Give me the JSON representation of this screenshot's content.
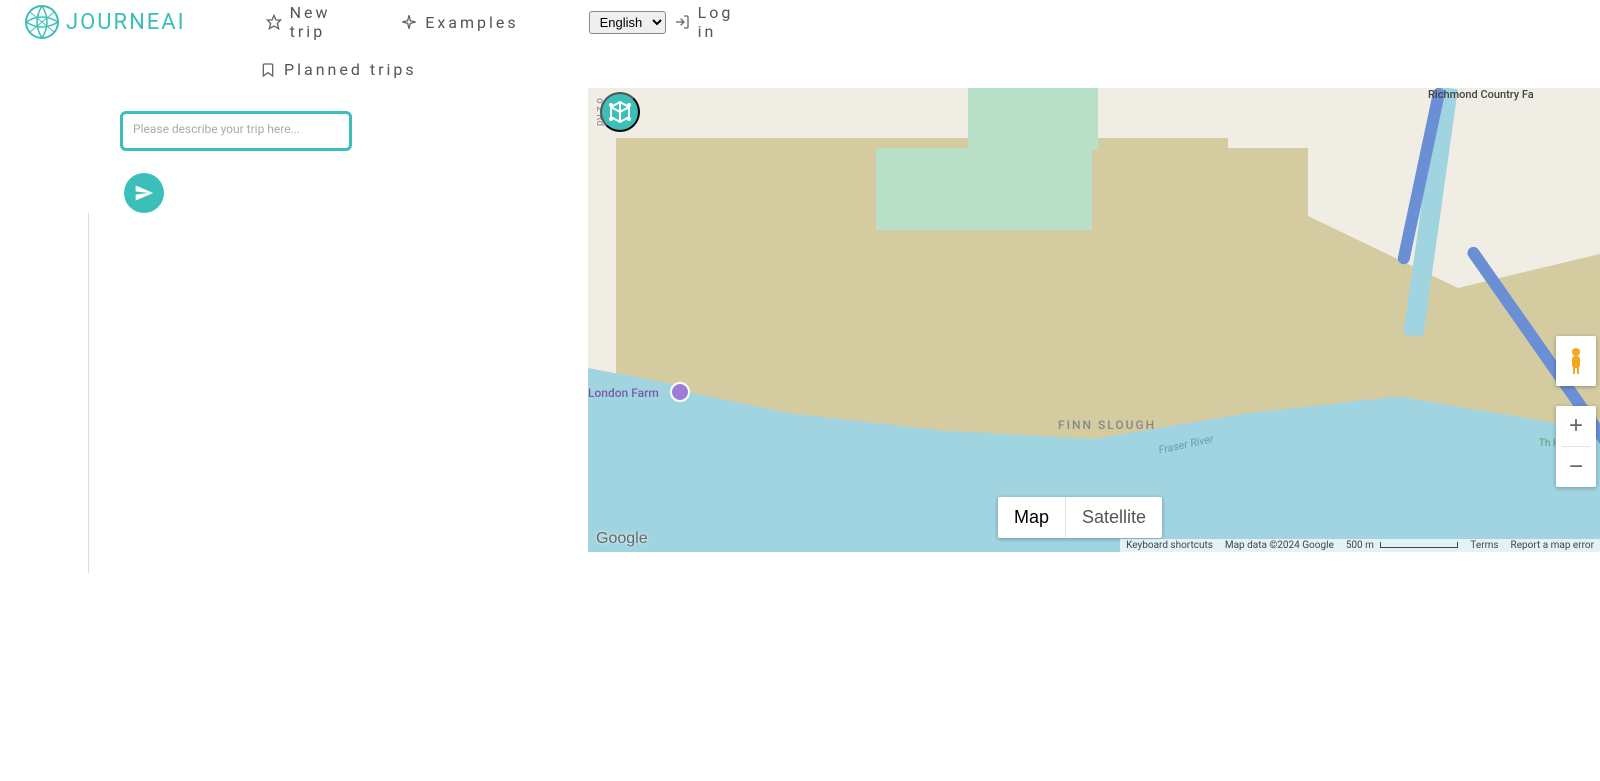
{
  "brand": {
    "name": "JOURNEAI"
  },
  "nav": {
    "new_trip": "New trip",
    "examples": "Examples",
    "planned_trips": "Planned trips",
    "login": "Log in"
  },
  "language": {
    "selected": "English",
    "options": [
      "English"
    ]
  },
  "input": {
    "placeholder": "Please describe your trip here..."
  },
  "map": {
    "type_map": "Map",
    "type_satellite": "Satellite",
    "pois": {
      "london_farm": "London Farm",
      "finn_slough": "FINN SLOUGH",
      "richmond_country": "Richmond Country Fa"
    },
    "road_labels": {
      "no2": "o 2 Rd"
    },
    "river": "Fraser River",
    "logo": "Google",
    "footer": {
      "keyboard": "Keyboard shortcuts",
      "data": "Map data ©2024 Google",
      "scale": "500 m",
      "terms": "Terms",
      "report": "Report a map error"
    },
    "green_label": "Th Hampt ov"
  }
}
